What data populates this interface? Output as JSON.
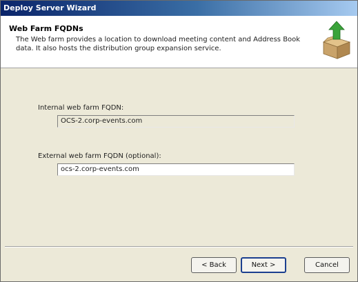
{
  "window": {
    "title": "Deploy Server Wizard"
  },
  "header": {
    "title": "Web Farm FQDNs",
    "description": "The Web farm provides a location to download meeting content and Address Book data. It also hosts the distribution group expansion service.",
    "icon": "box-with-green-arrow-icon"
  },
  "form": {
    "internal_label": "Internal web farm FQDN:",
    "internal_value": "OCS-2.corp-events.com",
    "external_label": "External web farm FQDN (optional):",
    "external_value": "ocs-2.corp-events.com"
  },
  "buttons": {
    "back": "< Back",
    "next": "Next >",
    "cancel": "Cancel"
  },
  "colors": {
    "title_bar": "#0a246a",
    "dialog_bg": "#ece9d8",
    "arrow_green": "#3aa33a",
    "box_tan": "#c9a36a"
  }
}
